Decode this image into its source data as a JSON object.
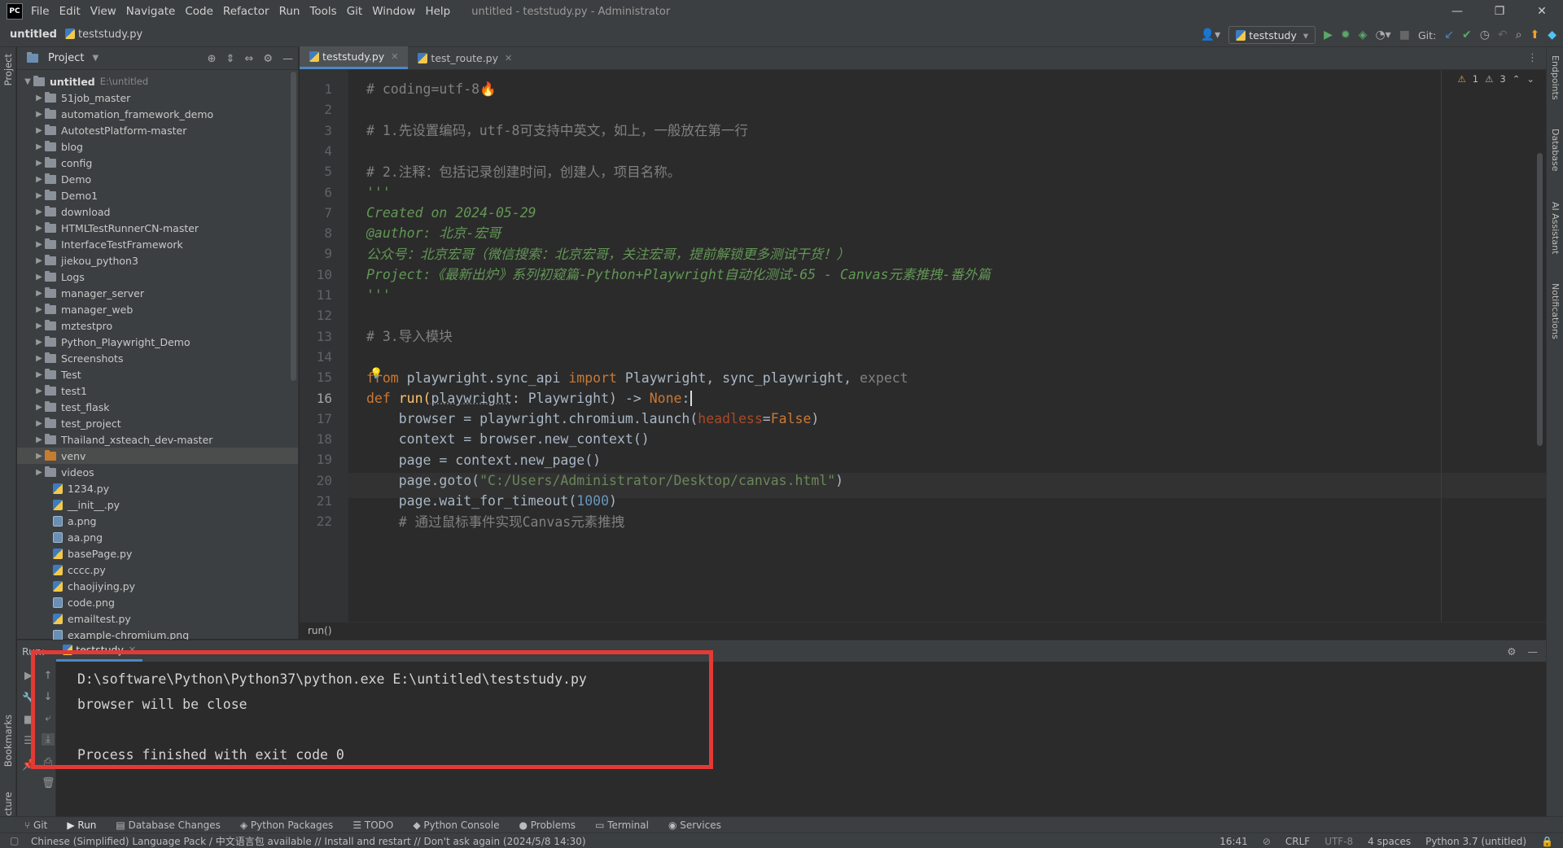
{
  "app": {
    "logo": "PC",
    "menu": [
      "File",
      "Edit",
      "View",
      "Navigate",
      "Code",
      "Refactor",
      "Run",
      "Tools",
      "Git",
      "Window",
      "Help"
    ],
    "window_title": "untitled - teststudy.py - Administrator",
    "window_controls": [
      "—",
      "❐",
      "✕"
    ]
  },
  "navbar": {
    "project": "untitled",
    "file": "teststudy.py",
    "run_config": "teststudy",
    "git_label": "Git:"
  },
  "project_panel": {
    "title": "Project",
    "root": "untitled",
    "root_path": "E:\\untitled",
    "folders": [
      "51job_master",
      "automation_framework_demo",
      "AutotestPlatform-master",
      "blog",
      "config",
      "Demo",
      "Demo1",
      "download",
      "HTMLTestRunnerCN-master",
      "InterfaceTestFramework",
      "jiekou_python3",
      "Logs",
      "manager_server",
      "manager_web",
      "mztestpro",
      "Python_Playwright_Demo",
      "Screenshots",
      "Test",
      "test1",
      "test_flask",
      "test_project",
      "Thailand_xsteach_dev-master",
      "venv",
      "videos"
    ],
    "files": [
      "1234.py",
      "__init__.py",
      "a.png",
      "aa.png",
      "basePage.py",
      "cccc.py",
      "chaojiying.py",
      "code.png",
      "emailtest.py",
      "example-chromium.png"
    ]
  },
  "editor": {
    "tabs": [
      {
        "label": "teststudy.py",
        "active": true
      },
      {
        "label": "test_route.py",
        "active": false
      }
    ],
    "inspections": {
      "warnings": "1",
      "weak_warnings": "3"
    },
    "current_line": 16,
    "line_numbers": [
      "1",
      "2",
      "3",
      "4",
      "5",
      "6",
      "7",
      "8",
      "9",
      "10",
      "11",
      "12",
      "13",
      "14",
      "15",
      "16",
      "17",
      "18",
      "19",
      "20",
      "21",
      "22"
    ],
    "breadcrumb": "run()",
    "code": {
      "l1": "# coding=utf-8🔥",
      "l3": "# 1.先设置编码，utf-8可支持中英文，如上，一般放在第一行",
      "l5": "# 2.注释：包括记录创建时间，创建人，项目名称。",
      "l6": "'''",
      "l7": "Created on 2024-05-29",
      "l8": "@author: 北京-宏哥",
      "l9": "公众号：北京宏哥（微信搜索：北京宏哥，关注宏哥，提前解锁更多测试干货！）",
      "l10": "Project:《最新出炉》系列初窥篇-Python+Playwright自动化测试-65 - Canvas元素推拽-番外篇",
      "l11": "'''",
      "l13": "# 3.导入模块",
      "l15_from": "from",
      "l15_mod": " playwright.sync_api ",
      "l15_import": "import",
      "l15_names": " Playwright, sync_playwright,",
      "l15_unused": " expect",
      "l16_def": "def",
      "l16_name": " run(",
      "l16_param": "playwright",
      "l16_rest": ": Playwright) -> ",
      "l16_none": "None",
      "l16_colon": ":",
      "l17_a": "    browser = playwright.chromium.launch(",
      "l17_kw": "headless",
      "l17_eq": "=",
      "l17_val": "False",
      "l17_b": ")",
      "l18": "    context = browser.new_context()",
      "l19": "    page = context.new_page()",
      "l20_a": "    page.goto(",
      "l20_str": "\"C:/Users/Administrator/Desktop/canvas.html\"",
      "l20_b": ")",
      "l21_a": "    page.wait_for_timeout(",
      "l21_num": "1000",
      "l21_b": ")",
      "l22": "    # 通过鼠标事件实现Canvas元素推拽"
    }
  },
  "run_panel": {
    "label": "Run:",
    "tab": "teststudy",
    "console": [
      "D:\\software\\Python\\Python37\\python.exe E:\\untitled\\teststudy.py",
      "browser will be close",
      "",
      "Process finished with exit code 0"
    ],
    "highlight_color": "#e53935"
  },
  "left_stripe": {
    "project": "Project",
    "bookmarks": "Bookmarks",
    "structure": "Structure"
  },
  "right_stripe": [
    "Endpoints",
    "Database",
    "AI Assistant",
    "Notifications"
  ],
  "bottom_tabs": [
    "Git",
    "Run",
    "Database Changes",
    "Python Packages",
    "TODO",
    "Python Console",
    "Problems",
    "Terminal",
    "Services"
  ],
  "status": {
    "message": "Chinese (Simplified) Language Pack / 中文语言包 available // Install and restart // Don't ask again (2024/5/8 14:30)",
    "position": "16:41",
    "line_sep": "CRLF",
    "encoding": "UTF-8",
    "indent": "4 spaces",
    "interpreter": "Python 3.7 (untitled)"
  }
}
